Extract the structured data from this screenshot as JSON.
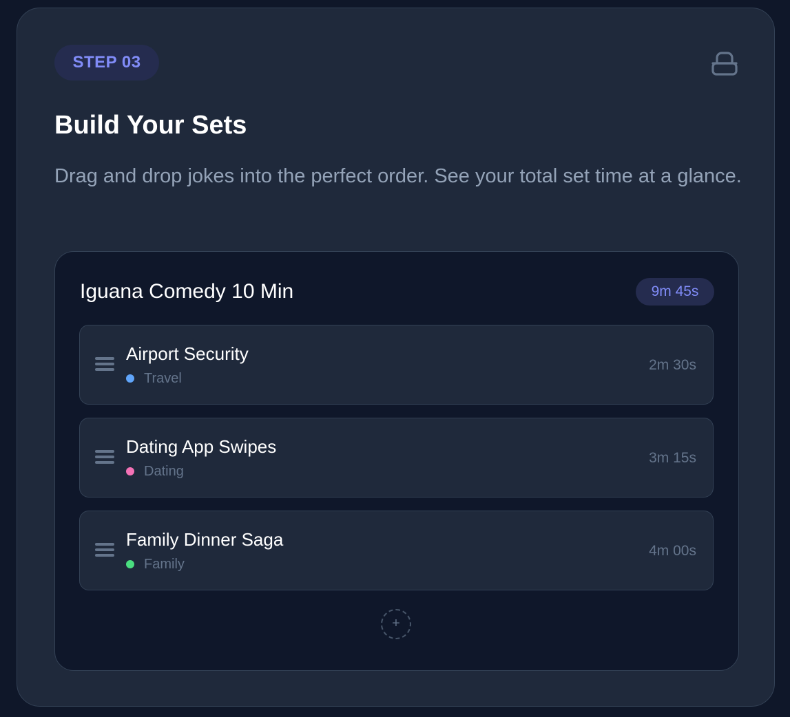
{
  "step": {
    "label": "STEP 03"
  },
  "icons": {
    "top_right": "stack-icon",
    "drag": "drag-handle-icon",
    "add": "plus-icon"
  },
  "title": "Build Your Sets",
  "description": "Drag and drop jokes into the perfect order. See your total set time at a glance.",
  "set": {
    "name": "Iguana Comedy 10 Min",
    "total_time": "9m 45s",
    "jokes": [
      {
        "title": "Airport Security",
        "category": "Travel",
        "category_color": "#60a5fa",
        "duration": "2m 30s"
      },
      {
        "title": "Dating App Swipes",
        "category": "Dating",
        "category_color": "#f472b6",
        "duration": "3m 15s"
      },
      {
        "title": "Family Dinner Saga",
        "category": "Family",
        "category_color": "#4ade80",
        "duration": "4m 00s"
      }
    ],
    "add_label": "+"
  },
  "colors": {
    "accent": "#818cf8",
    "card_bg": "#1f293b",
    "panel_bg": "#0f172a",
    "page_bg": "#0f1729"
  }
}
